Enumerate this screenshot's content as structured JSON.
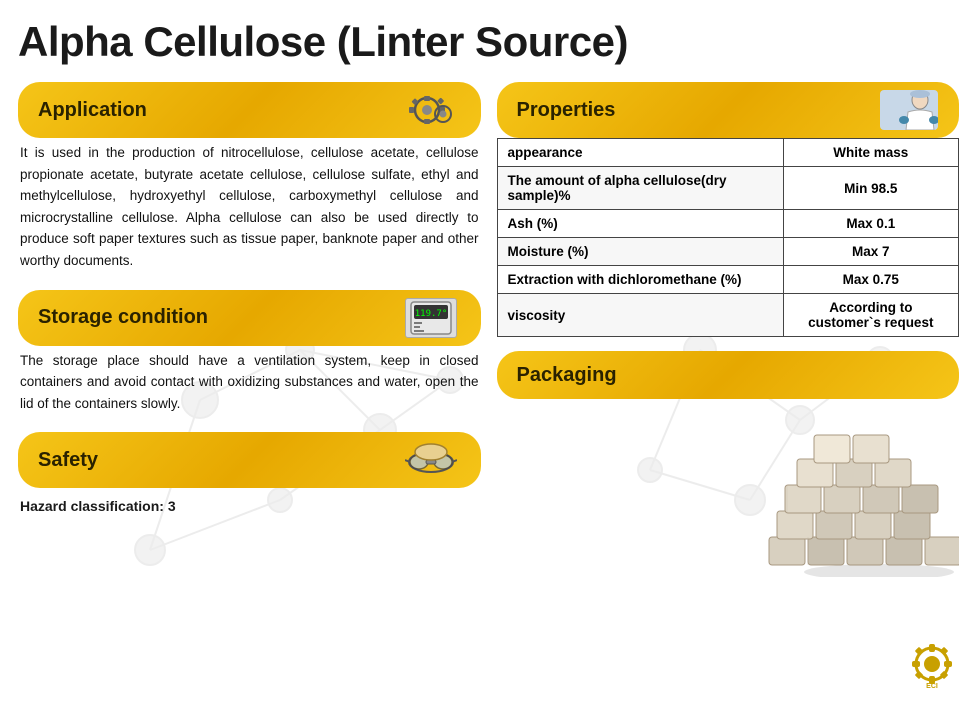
{
  "page": {
    "title": "Alpha Cellulose (Linter Source)"
  },
  "application": {
    "header": "Application",
    "body": "It is used in the production of nitrocellulose, cellulose acetate, cellulose propionate acetate, butyrate acetate cellulose, cellulose sulfate, ethyl and methylcellulose, hydroxyethyl cellulose, carboxymethyl cellulose and microcrystalline cellulose. Alpha cellulose can also be used directly to produce soft paper textures such as tissue paper, banknote paper and other worthy documents."
  },
  "storage": {
    "header": "Storage condition",
    "body": "The storage place should have a ventilation system, keep in closed containers and avoid contact with oxidizing substances and water, open the lid of the containers slowly."
  },
  "safety": {
    "header": "Safety",
    "hazard": "Hazard classification: 3"
  },
  "properties": {
    "header": "Properties",
    "rows": [
      {
        "property": "appearance",
        "value": "White mass"
      },
      {
        "property": "The amount of alpha cellulose(dry sample)%",
        "value": "Min 98.5"
      },
      {
        "property": "Ash (%)",
        "value": "Max 0.1"
      },
      {
        "property": "Moisture (%)",
        "value": "Max 7"
      },
      {
        "property": "Extraction with dichloromethane (%)",
        "value": "Max 0.75"
      },
      {
        "property": "viscosity",
        "value": "According to customer`s request"
      }
    ]
  },
  "packaging": {
    "header": "Packaging"
  }
}
